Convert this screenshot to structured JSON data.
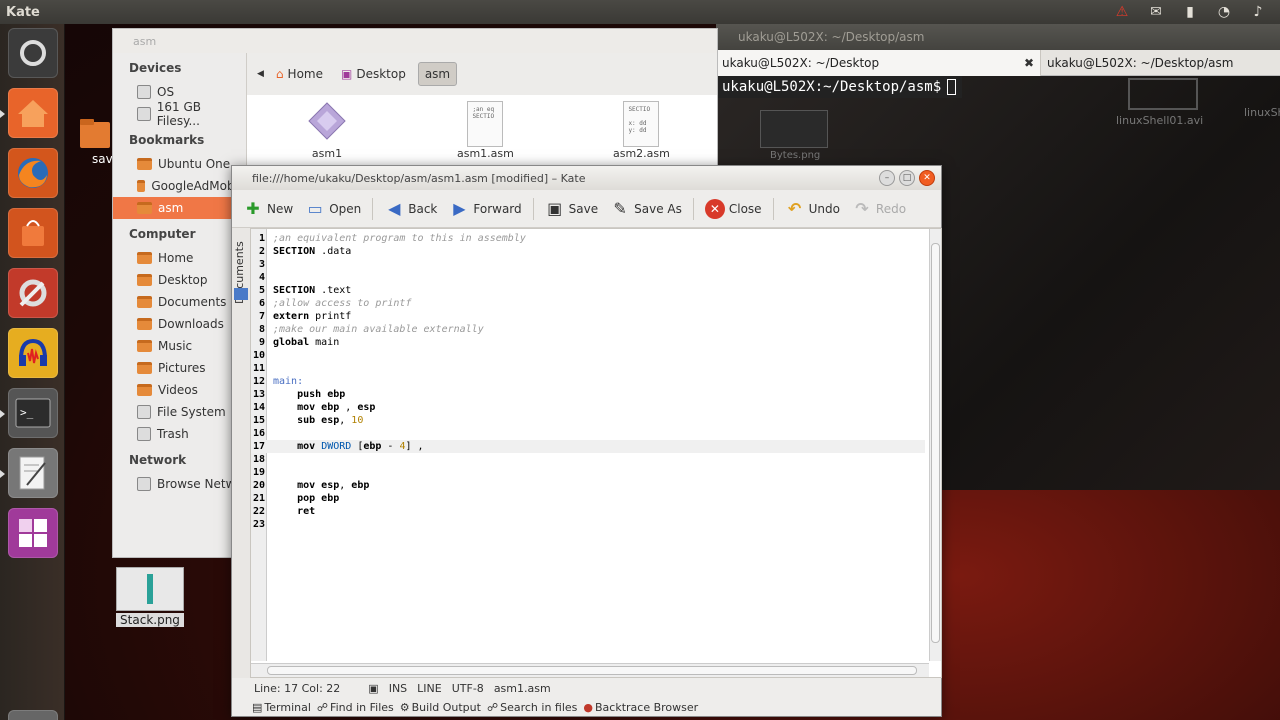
{
  "panel": {
    "app_title": "Kate"
  },
  "desktop": {
    "save_icon_label": "sav",
    "stack_label": "Stack.png",
    "terminal_bg_labels": [
      "linuxShell01.avi",
      "linuxSh",
      "Bytes.png"
    ]
  },
  "terminal": {
    "title": "ukaku@L502X: ~/Desktop/asm",
    "tab1": "ukaku@L502X: ~/Desktop",
    "tab2": "ukaku@L502X: ~/Desktop/asm",
    "prompt": "ukaku@L502X:~/Desktop/asm$"
  },
  "nautilus": {
    "title": "asm",
    "sections": {
      "devices": "Devices",
      "bookmarks": "Bookmarks",
      "computer": "Computer",
      "network": "Network"
    },
    "devices": [
      "OS",
      "161 GB Filesy..."
    ],
    "bookmarks": [
      "Ubuntu One",
      "GoogleAdMob...",
      "asm"
    ],
    "computer": [
      "Home",
      "Desktop",
      "Documents",
      "Downloads",
      "Music",
      "Pictures",
      "Videos",
      "File System",
      "Trash"
    ],
    "network": [
      "Browse Netw..."
    ],
    "breadcrumbs": [
      "Home",
      "Desktop",
      "asm"
    ],
    "files": [
      {
        "name": "asm1",
        "preview": ""
      },
      {
        "name": "asm1.asm",
        "preview": ";an eq\nSECTIO"
      },
      {
        "name": "asm2.asm",
        "preview": "SECTIO\n\nx: dd\ny: dd"
      }
    ]
  },
  "kate": {
    "title": "file:///home/ukaku/Desktop/asm/asm1.asm [modified] – Kate",
    "toolbar": {
      "new": "New",
      "open": "Open",
      "back": "Back",
      "forward": "Forward",
      "save": "Save",
      "save_as": "Save As",
      "close": "Close",
      "undo": "Undo",
      "redo": "Redo"
    },
    "documents_tab": "Documents",
    "code": [
      {
        "n": "1",
        "html": "<span class=\"cm\">;an equivalent program to this in assembly</span>"
      },
      {
        "n": "2",
        "html": "<span class=\"kw\">SECTION</span> .data"
      },
      {
        "n": "3",
        "html": ""
      },
      {
        "n": "4",
        "html": ""
      },
      {
        "n": "5",
        "html": "<span class=\"kw\">SECTION</span> .text"
      },
      {
        "n": "6",
        "html": "<span class=\"cm\">;allow access to printf</span>"
      },
      {
        "n": "7",
        "html": "<span class=\"kw\">extern</span> printf"
      },
      {
        "n": "8",
        "html": "<span class=\"cm\">;make our main available externally</span>"
      },
      {
        "n": "9",
        "html": "<span class=\"kw\">global</span> main"
      },
      {
        "n": "10",
        "html": ""
      },
      {
        "n": "11",
        "html": ""
      },
      {
        "n": "12",
        "html": "<span class=\"lbl\">main:</span>"
      },
      {
        "n": "13",
        "html": "    <span class=\"kw\">push ebp</span>"
      },
      {
        "n": "14",
        "html": "    <span class=\"kw\">mov ebp</span> , <span class=\"kw\">esp</span>"
      },
      {
        "n": "15",
        "html": "    <span class=\"kw\">sub esp</span>, <span class=\"num\">10</span>"
      },
      {
        "n": "16",
        "html": ""
      },
      {
        "n": "17",
        "html": "    <span class=\"kw\">mov</span> <span class=\"typ\">DWORD</span> [<span class=\"kw\">ebp</span> - <span class=\"num\">4</span>] ,",
        "current": true
      },
      {
        "n": "18",
        "html": ""
      },
      {
        "n": "19",
        "html": ""
      },
      {
        "n": "20",
        "html": "    <span class=\"kw\">mov esp</span>, <span class=\"kw\">ebp</span>"
      },
      {
        "n": "21",
        "html": "    <span class=\"kw\">pop ebp</span>"
      },
      {
        "n": "22",
        "html": "    <span class=\"kw\">ret</span>"
      },
      {
        "n": "23",
        "html": ""
      }
    ],
    "status": {
      "position": "Line: 17 Col: 22",
      "mode": "INS",
      "selection": "LINE",
      "encoding": "UTF-8",
      "filename": "asm1.asm"
    },
    "bottom_tools": [
      "Terminal",
      "Find in Files",
      "Build Output",
      "Search in files",
      "Backtrace Browser"
    ]
  },
  "colors": {
    "selection_orange": "#f07746",
    "panel_bg": "#3c3b37",
    "terminal_bg": "#300a24"
  }
}
